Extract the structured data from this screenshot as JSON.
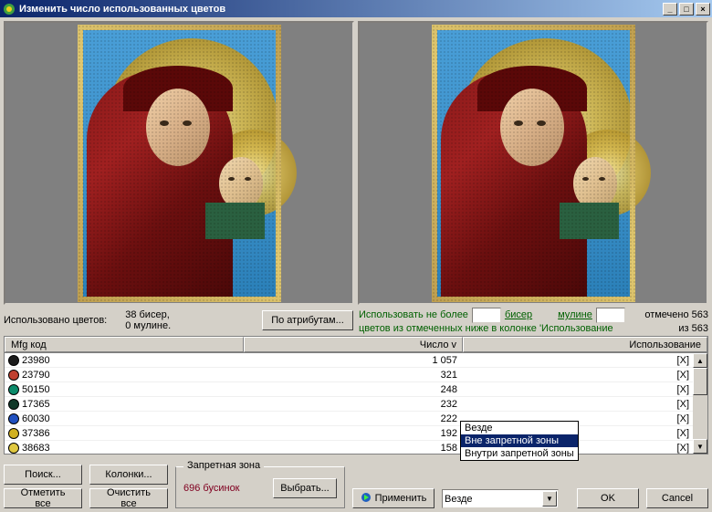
{
  "window": {
    "title": "Изменить число использованных цветов"
  },
  "info": {
    "used_label": "Использовано цветов:",
    "used_beads": "38 бисер,",
    "used_floss": "0 мулине.",
    "by_attrs_btn": "По атрибутам...",
    "use_max_prefix": "Использовать не более",
    "beads_link": "бисер",
    "floss_link": "мулине",
    "marked_text": "отмечено 563",
    "marked_suffix": "цветов из отмеченных ниже в колонке 'Использование",
    "of_count": "из 563"
  },
  "table": {
    "col_mfg": "Mfg код",
    "col_count": "Число v",
    "col_usage": "Использование",
    "rows": [
      {
        "color": "#1a1a1a",
        "code": "23980",
        "count": "1 057",
        "usage": "[X]"
      },
      {
        "color": "#c04030",
        "code": "23790",
        "count": "321",
        "usage": "[X]"
      },
      {
        "color": "#0a8a6a",
        "code": "50150",
        "count": "248",
        "usage": "[X]"
      },
      {
        "color": "#103828",
        "code": "17365",
        "count": "232",
        "usage": "[X]"
      },
      {
        "color": "#2050c0",
        "code": "60030",
        "count": "222",
        "usage": "[X]"
      },
      {
        "color": "#d0b020",
        "code": "37386",
        "count": "192",
        "usage": "[X]"
      },
      {
        "color": "#e0c840",
        "code": "38683",
        "count": "158",
        "usage": "[X]"
      }
    ]
  },
  "buttons": {
    "search": "Поиск...",
    "columns": "Колонки...",
    "mark_all": "Отметить все",
    "clear_all": "Очистить все",
    "select": "Выбрать...",
    "apply": "Применить",
    "ok": "OK",
    "cancel": "Cancel"
  },
  "zone": {
    "legend": "Запретная зона",
    "bead_count": "696 бусинок"
  },
  "combo": {
    "selected": "Везде",
    "options": [
      "Везде",
      "Вне запретной зоны",
      "Внутри запретной зоны"
    ]
  }
}
